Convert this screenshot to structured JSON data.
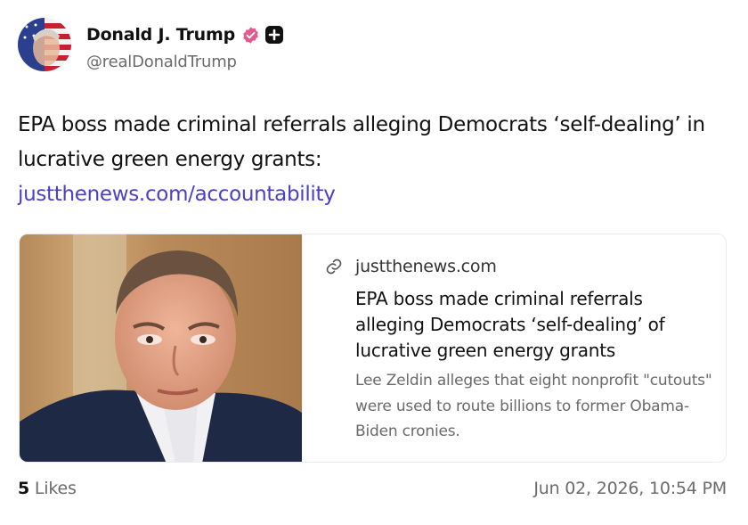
{
  "author": {
    "name": "Donald J. Trump",
    "handle": "@realDonaldTrump",
    "verified_color": "#e4598f"
  },
  "post": {
    "text": "EPA boss made criminal referrals alleging Democrats ‘self-dealing’ in lucrative green energy grants:",
    "link": "justthenews.com/accountability",
    "link_color": "#4b3fc5"
  },
  "card": {
    "source": "justthenews.com",
    "title": "EPA boss made criminal referrals alleging Democrats ‘self-dealing’ of lucrative green energy grants",
    "description": "Lee Zeldin alleges that eight nonprofit \"cutouts\" were used to route billions to former Obama-Biden cronies.",
    "icon": "link-icon"
  },
  "footer": {
    "likes_count": "5",
    "likes_label": " Likes",
    "timestamp": "Jun 02, 2026, 10:54 PM"
  }
}
